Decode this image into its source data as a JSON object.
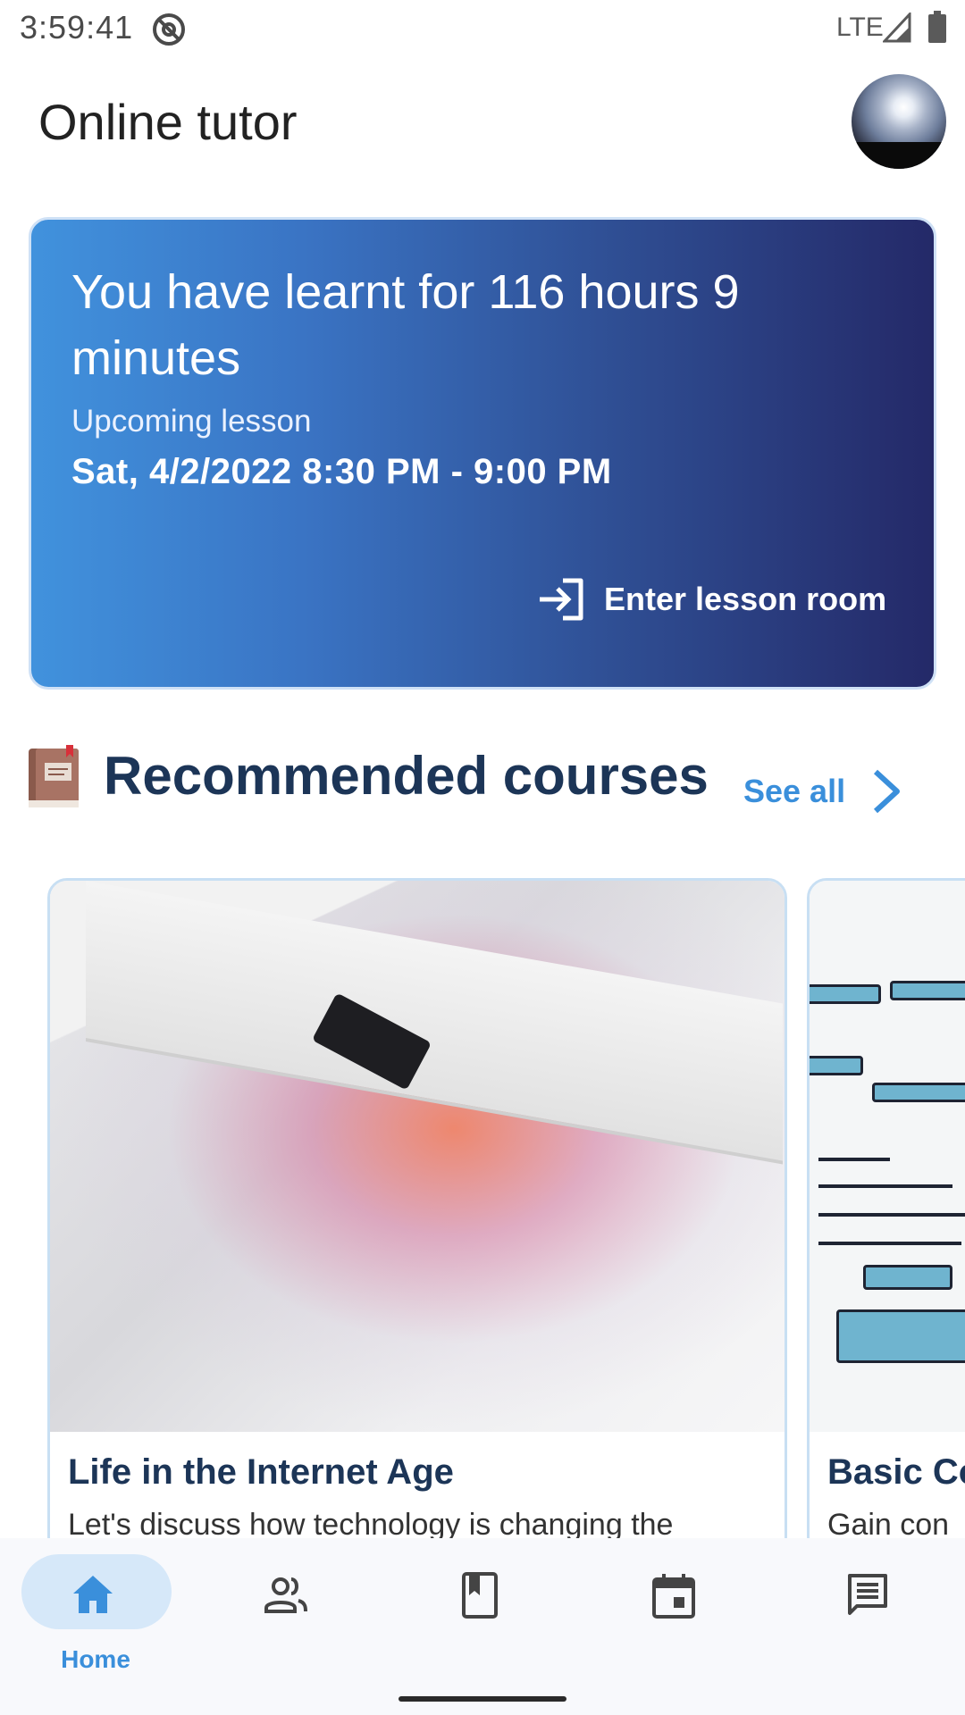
{
  "status_bar": {
    "time": "3:59:41",
    "network": "LTE"
  },
  "header": {
    "title": "Online tutor"
  },
  "hero": {
    "title": "You have learnt for 116 hours 9 minutes",
    "upcoming_label": "Upcoming lesson",
    "lesson_time": "Sat, 4/2/2022 8:30 PM - 9:00 PM",
    "enter_label": "Enter lesson room"
  },
  "recommended": {
    "title": "Recommended courses",
    "see_all_label": "See all",
    "courses": [
      {
        "title": "Life in the Internet Age",
        "description": "Let's discuss how technology is changing the"
      },
      {
        "title": "Basic Co",
        "description": "Gain con"
      }
    ]
  },
  "bottom_nav": {
    "items": [
      {
        "label": "Home",
        "icon": "home-icon",
        "active": true
      },
      {
        "label": "",
        "icon": "tutors-icon",
        "active": false
      },
      {
        "label": "",
        "icon": "courses-icon",
        "active": false
      },
      {
        "label": "",
        "icon": "schedule-icon",
        "active": false
      },
      {
        "label": "",
        "icon": "messages-icon",
        "active": false
      }
    ]
  },
  "colors": {
    "accent": "#3a8fdb",
    "heading": "#1c3557",
    "hero_gradient_start": "#4192dd",
    "hero_gradient_end": "#242968"
  }
}
